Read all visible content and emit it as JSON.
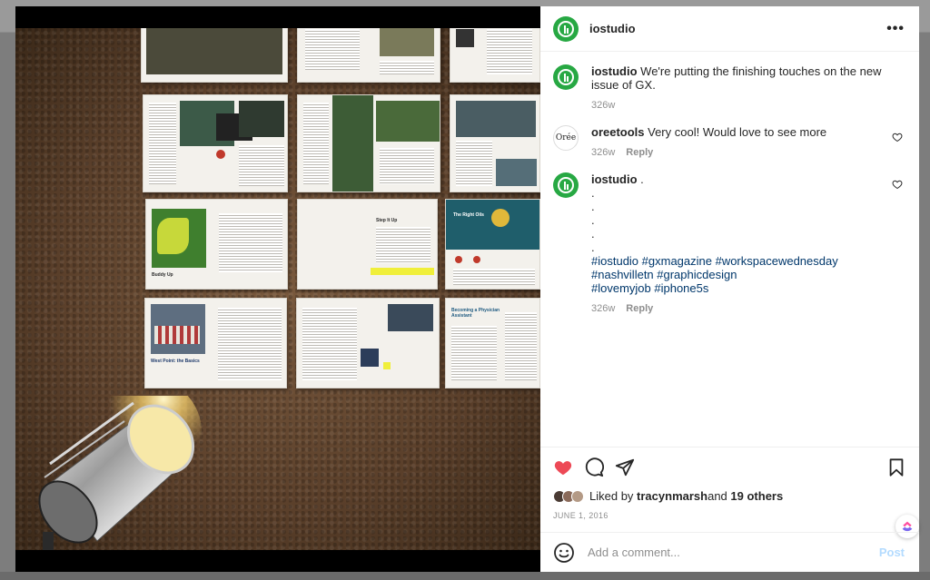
{
  "post": {
    "username": "iostudio",
    "more_label": "•••"
  },
  "comments": [
    {
      "username": "iostudio",
      "text": " We're putting the finishing touches on the new issue of GX.",
      "time": "326w"
    },
    {
      "username": "oreetools",
      "avatar_text": "Orée",
      "text": " Very cool! Would love to see more",
      "time": "326w",
      "reply": "Reply"
    },
    {
      "username": "iostudio",
      "text": " .",
      "dots": [
        ".",
        ".",
        ".",
        ".",
        "."
      ],
      "tags_line1": "#iostudio #gxmagazine #workspacewednesday #nashvilletn #graphicdesign",
      "tags_line2": "#lovemyjob #iphone5s",
      "time": "326w",
      "reply": "Reply"
    }
  ],
  "likes": {
    "prefix": "Liked by ",
    "user": "tracynmarsh",
    "middle": " and ",
    "others": "19 others"
  },
  "date": "JUNE 1, 2016",
  "add_comment": {
    "placeholder": "Add a comment...",
    "post_label": "Post"
  },
  "photo_pages": {
    "buddy_up": "Buddy Up",
    "west_point": "West Point: the Basics",
    "right_oils": "The Right Oils",
    "step_it_up": "Step It Up",
    "physician": "Becoming a Physician Assistant"
  },
  "colors": {
    "accent_green": "#27a843",
    "like_red": "#ed4956",
    "link_blue": "#00376b",
    "post_disabled": "#b3dbff"
  },
  "icons": [
    "heart-icon",
    "comment-icon",
    "share-icon",
    "bookmark-icon",
    "emoji-icon",
    "more-icon",
    "clickup-icon"
  ]
}
